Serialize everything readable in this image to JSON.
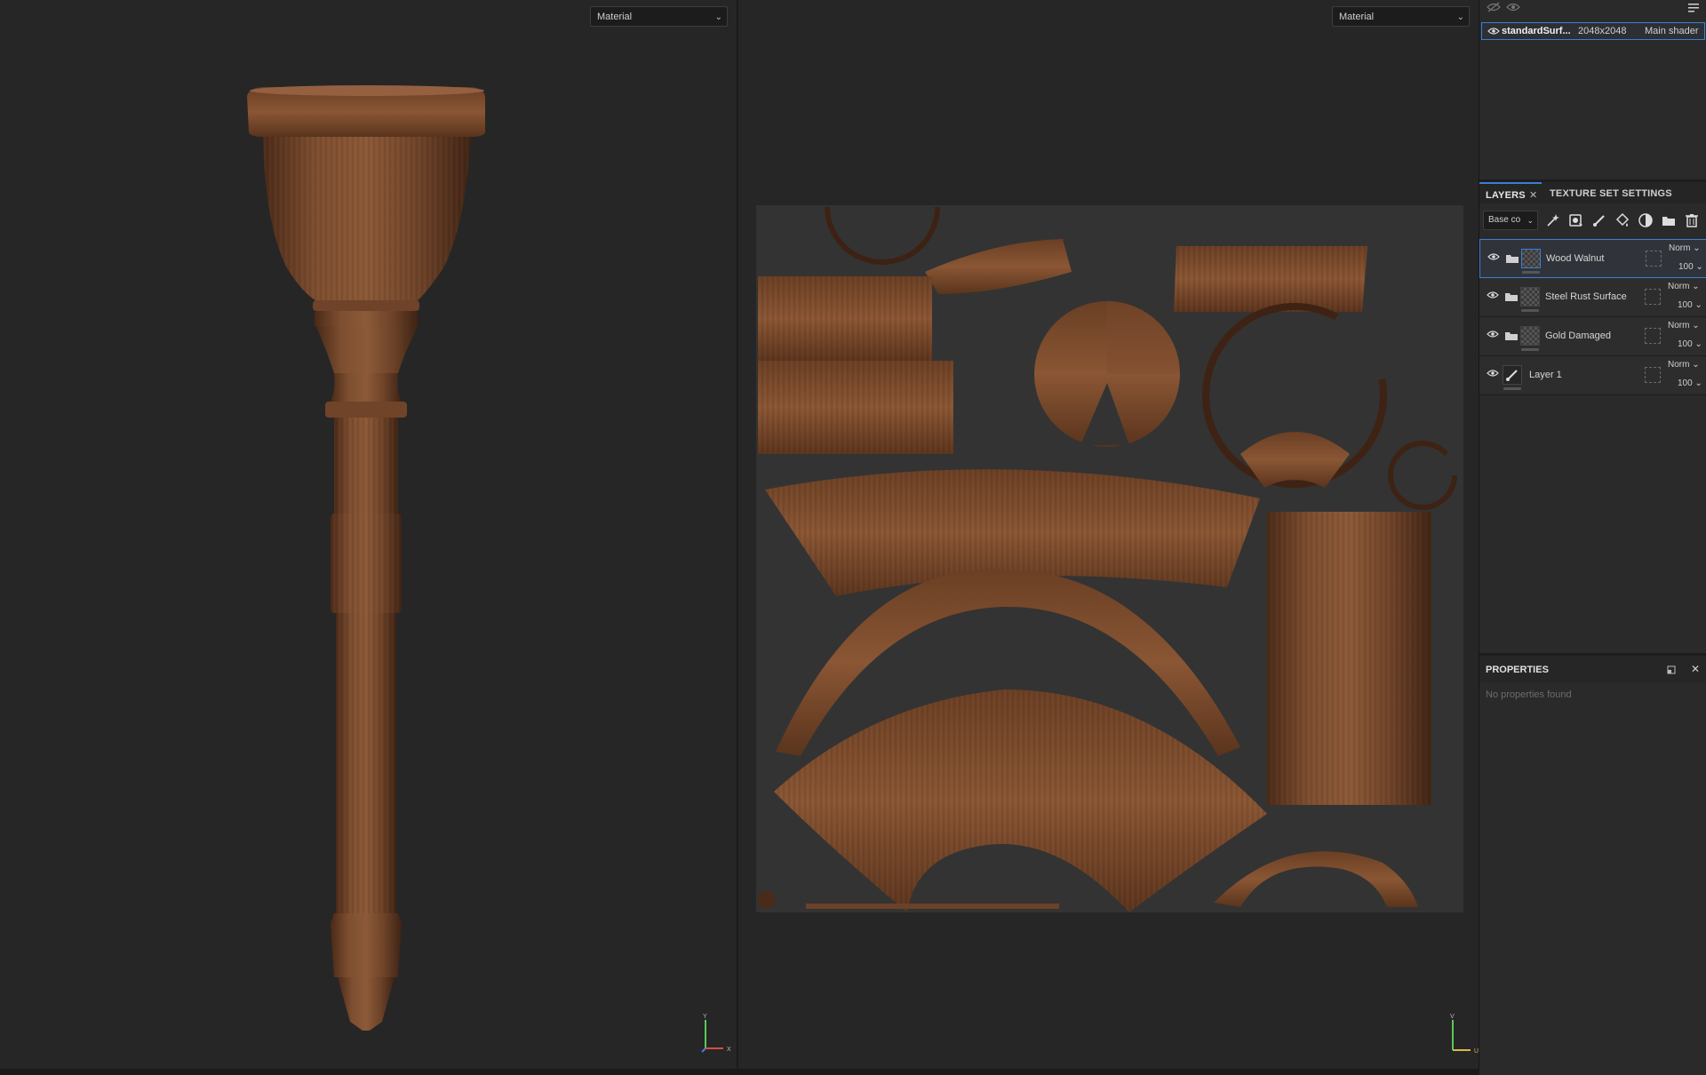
{
  "viewport_3d": {
    "material_dropdown": "Material",
    "axis": {
      "y": "Y",
      "x": "X"
    }
  },
  "viewport_2d": {
    "material_dropdown": "Material",
    "axis": {
      "v": "V",
      "u": "U"
    }
  },
  "texture_set": {
    "name": "standardSurf...",
    "resolution": "2048x2048",
    "shader": "Main shader"
  },
  "tabs": [
    {
      "label": "LAYERS",
      "active": true
    },
    {
      "label": "TEXTURE SET SETTINGS",
      "active": false
    }
  ],
  "layers_toolbar": {
    "channel": "Base co",
    "icons": [
      "add-effect-icon",
      "add-mask-icon",
      "add-paint-layer-icon",
      "add-fill-layer-icon",
      "smart-material-icon",
      "add-folder-icon",
      "delete-icon"
    ]
  },
  "layers": [
    {
      "name": "Wood Walnut",
      "type": "folder",
      "blend": "Norm",
      "opacity": "100",
      "selected": true
    },
    {
      "name": "Steel Rust Surface",
      "type": "folder",
      "blend": "Norm",
      "opacity": "100",
      "selected": false
    },
    {
      "name": "Gold Damaged",
      "type": "folder",
      "blend": "Norm",
      "opacity": "100",
      "selected": false
    },
    {
      "name": "Layer 1",
      "type": "paint",
      "blend": "Norm",
      "opacity": "100",
      "selected": false
    }
  ],
  "properties": {
    "title": "PROPERTIES",
    "empty_text": "No properties found"
  },
  "colors": {
    "accent": "#3a7fd6",
    "wood": "#7a4a2c",
    "uv_background": "#333333"
  }
}
